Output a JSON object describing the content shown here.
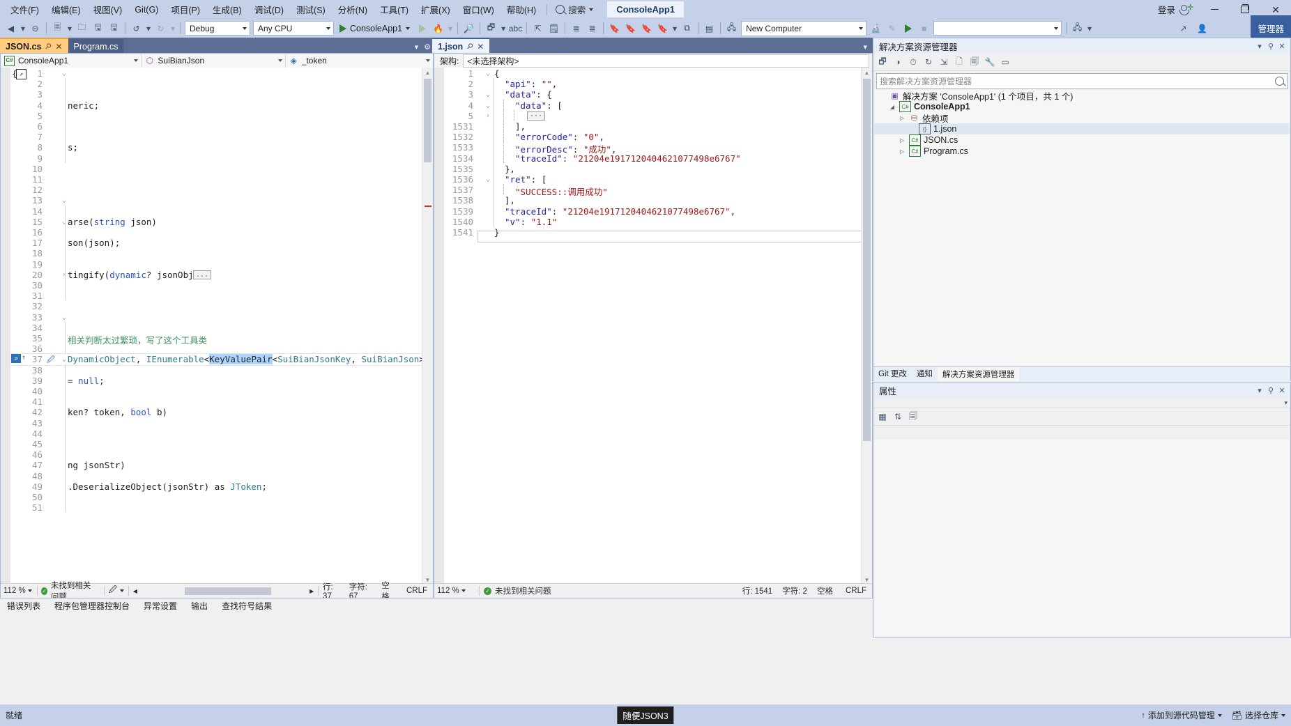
{
  "window": {
    "app_title": "ConsoleApp1",
    "signin_label": "登录",
    "minimize": "—",
    "maximize": "□",
    "close": "✕"
  },
  "menu": {
    "items": [
      {
        "label": "文件(F)"
      },
      {
        "label": "编辑(E)"
      },
      {
        "label": "视图(V)"
      },
      {
        "label": "Git(G)"
      },
      {
        "label": "项目(P)"
      },
      {
        "label": "生成(B)"
      },
      {
        "label": "调试(D)"
      },
      {
        "label": "测试(S)"
      },
      {
        "label": "分析(N)"
      },
      {
        "label": "工具(T)"
      },
      {
        "label": "扩展(X)"
      },
      {
        "label": "窗口(W)"
      },
      {
        "label": "帮助(H)"
      }
    ],
    "search_placeholder": "搜索"
  },
  "toolbar": {
    "config": "Debug",
    "platform": "Any CPU",
    "run_target": "ConsoleApp1",
    "computer": "New Computer",
    "empty_combo": "",
    "manage_label": "管理器",
    "icons": [
      "back-arrow-icon",
      "forward-arrow-icon",
      "new-project-icon",
      "open-file-icon",
      "save-icon",
      "save-all-icon",
      "undo-icon",
      "redo-icon"
    ]
  },
  "tabs": {
    "left_group": [
      {
        "label": "JSON.cs",
        "active": true
      },
      {
        "label": "Program.cs",
        "active": false
      }
    ],
    "right_group": [
      {
        "label": "1.json",
        "active": true
      }
    ]
  },
  "cs_editor": {
    "nav": {
      "project": "ConsoleApp1",
      "type": "SuiBianJson",
      "member": "_token"
    },
    "lines": [
      {
        "num": "1",
        "fold": "v",
        "text": "",
        "indent": 0
      },
      {
        "num": "2",
        "text": "",
        "indent": 1
      },
      {
        "num": "3",
        "text": "",
        "indent": 1
      },
      {
        "num": "4",
        "text": "neric;",
        "indent": 1
      },
      {
        "num": "5",
        "text": "",
        "indent": 1
      },
      {
        "num": "6",
        "text": "",
        "indent": 1
      },
      {
        "num": "7",
        "text": "",
        "indent": 1
      },
      {
        "num": "8",
        "text": "s;",
        "indent": 1
      },
      {
        "num": "9",
        "text": "",
        "indent": 1
      },
      {
        "num": "10",
        "text": "",
        "indent": 0
      },
      {
        "num": "11",
        "text": "",
        "indent": 0
      },
      {
        "num": "12",
        "text": "",
        "indent": 0
      },
      {
        "num": "13",
        "fold": "v",
        "text": "",
        "indent": 0
      },
      {
        "num": "14",
        "text": "",
        "indent": 1
      },
      {
        "num": "15",
        "fold": "v",
        "text": "arse(string json)",
        "indent": 1
      },
      {
        "num": "16",
        "text": "",
        "indent": 1
      },
      {
        "num": "17",
        "text": "son(json);",
        "indent": 1
      },
      {
        "num": "18",
        "text": "",
        "indent": 1
      },
      {
        "num": "19",
        "text": "",
        "indent": 1
      },
      {
        "num": "20",
        "fold": ">",
        "text": "tingify(dynamic? jsonObj)",
        "indent": 1,
        "ellipsis": true
      },
      {
        "num": "30",
        "text": "",
        "indent": 1
      },
      {
        "num": "31",
        "text": "",
        "indent": 1
      },
      {
        "num": "32",
        "text": "",
        "indent": 0
      },
      {
        "num": "33",
        "fold": "v",
        "text": "",
        "indent": 0
      },
      {
        "num": "34",
        "text": "",
        "indent": 1
      },
      {
        "num": "35",
        "text": "相关判断太过繁琐，写了这个工具类",
        "indent": 1,
        "comment": true
      },
      {
        "num": "36",
        "text": "",
        "indent": 1
      },
      {
        "num": "37",
        "fold": "v",
        "text": "DynamicObject, IEnumerable<KeyValuePair<SuiBianJsonKey, SuiBianJson>>",
        "indent": 0,
        "current": true,
        "selection": "KeyValuePair"
      },
      {
        "num": "38",
        "text": "",
        "indent": 1
      },
      {
        "num": "39",
        "text": "= null;",
        "indent": 1
      },
      {
        "num": "40",
        "text": "",
        "indent": 1
      },
      {
        "num": "41",
        "text": "",
        "indent": 1
      },
      {
        "num": "42",
        "text": "ken? token, bool b)",
        "indent": 1
      },
      {
        "num": "43",
        "text": "",
        "indent": 1
      },
      {
        "num": "44",
        "text": "",
        "indent": 1
      },
      {
        "num": "45",
        "text": "",
        "indent": 1
      },
      {
        "num": "46",
        "text": "",
        "indent": 1
      },
      {
        "num": "47",
        "text": "ng jsonStr)",
        "indent": 1
      },
      {
        "num": "48",
        "text": "",
        "indent": 1
      },
      {
        "num": "49",
        "text": ".DeserializeObject(jsonStr) as JToken;",
        "indent": 1
      },
      {
        "num": "50",
        "text": "",
        "indent": 1
      },
      {
        "num": "51",
        "text": "",
        "indent": 1
      }
    ],
    "status": {
      "zoom": "112 %",
      "issues": "未找到相关问题",
      "line_label": "行: 37",
      "col_label": "字符: 67",
      "space_label": "空格",
      "eol_label": "CRLF"
    }
  },
  "json_editor": {
    "schema_label": "架构:",
    "schema_value": "<未选择架构>",
    "lines": [
      {
        "num": "1",
        "fold": "v",
        "text": "{",
        "depth": 0
      },
      {
        "num": "2",
        "key": "\"api\"",
        "val": "\"\"",
        "depth": 1,
        "comma": true
      },
      {
        "num": "3",
        "fold": "v",
        "key": "\"data\"",
        "val": "{",
        "depth": 1
      },
      {
        "num": "4",
        "fold": "v",
        "key": "\"data\"",
        "val": "[",
        "depth": 2
      },
      {
        "num": "5",
        "fold": ">",
        "text": "",
        "depth": 3,
        "ellipsis": true
      },
      {
        "num": "1531",
        "text": "],",
        "depth": 2
      },
      {
        "num": "1532",
        "key": "\"errorCode\"",
        "val": "\"0\"",
        "depth": 2,
        "comma": true
      },
      {
        "num": "1533",
        "key": "\"errorDesc\"",
        "val": "\"成功\"",
        "depth": 2,
        "comma": true
      },
      {
        "num": "1534",
        "key": "\"traceId\"",
        "val": "\"21204e1917120404621077498e6767\"",
        "depth": 2
      },
      {
        "num": "1535",
        "text": "},",
        "depth": 1
      },
      {
        "num": "1536",
        "fold": "v",
        "key": "\"ret\"",
        "val": "[",
        "depth": 1
      },
      {
        "num": "1537",
        "val": "\"SUCCESS::调用成功\"",
        "depth": 2
      },
      {
        "num": "1538",
        "text": "],",
        "depth": 1
      },
      {
        "num": "1539",
        "key": "\"traceId\"",
        "val": "\"21204e1917120404621077498e6767\"",
        "depth": 1,
        "comma": true
      },
      {
        "num": "1540",
        "key": "\"v\"",
        "val": "\"1.1\"",
        "depth": 1
      },
      {
        "num": "1541",
        "text": "}",
        "depth": 0,
        "current": true
      }
    ],
    "status": {
      "zoom": "112 %",
      "issues": "未找到相关问题",
      "line_label": "行: 1541",
      "col_label": "字符: 2",
      "space_label": "空格",
      "eol_label": "CRLF"
    }
  },
  "solution_explorer": {
    "title": "解决方案资源管理器",
    "search_placeholder": "搜索解决方案资源管理器",
    "toolbar_icons": [
      "link-icon",
      "circle-fill-icon",
      "history-icon",
      "refresh-icon",
      "collapse-all-icon",
      "show-all-files-icon",
      "properties-icon",
      "home-icon",
      "preview-icon"
    ],
    "tree": [
      {
        "label": "解决方案 'ConsoleApp1' (1 个项目，共 1 个)",
        "indent": 0,
        "icon": "solution-icon",
        "twist": ""
      },
      {
        "label": "ConsoleApp1",
        "indent": 1,
        "icon": "csproj-icon",
        "twist": "▲",
        "bold": true
      },
      {
        "label": "依赖项",
        "indent": 2,
        "icon": "deps-icon",
        "twist": "▶"
      },
      {
        "label": "1.json",
        "indent": 3,
        "icon": "json-icon",
        "twist": "",
        "selected": true
      },
      {
        "label": "JSON.cs",
        "indent": 2,
        "icon": "cs-icon",
        "twist": "▶"
      },
      {
        "label": "Program.cs",
        "indent": 2,
        "icon": "cs-icon",
        "twist": "▶"
      }
    ],
    "bottom_tabs": [
      {
        "label": "Git 更改",
        "active": false
      },
      {
        "label": "通知",
        "active": false
      },
      {
        "label": "解决方案资源管理器",
        "active": true
      }
    ]
  },
  "properties_panel": {
    "title": "属性",
    "toolbar_icons": [
      "categorized-icon",
      "alphabetical-icon",
      "properties-page-icon"
    ]
  },
  "bottom_tool_tabs": [
    {
      "label": "错误列表"
    },
    {
      "label": "程序包管理器控制台"
    },
    {
      "label": "异常设置"
    },
    {
      "label": "输出"
    },
    {
      "label": "查找符号结果"
    }
  ],
  "taskbar": {
    "left_text": "就绪",
    "center_chip": "随便JSON3",
    "add_source_label": "添加到源代码管理",
    "repo_label": "选择仓库"
  },
  "colors": {
    "chrome": "#c5d1e8",
    "accent_blue": "#3a5f9e",
    "active_tab_orange": "#ffcc80",
    "docwell": "#5d6e94",
    "selection": "#add6ff",
    "comment_green": "#3f8f5f",
    "string_red": "#a31515",
    "keyword_blue": "#2b57c4"
  }
}
